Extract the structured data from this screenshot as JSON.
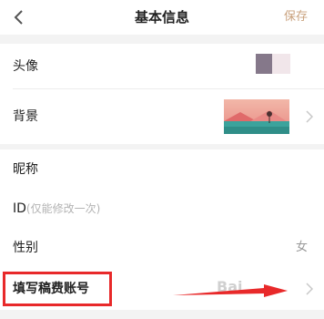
{
  "header": {
    "title": "基本信息",
    "save_label": "保存"
  },
  "rows": {
    "avatar": {
      "label": "头像"
    },
    "background": {
      "label": "背景"
    },
    "nickname": {
      "label": "昵称"
    },
    "id": {
      "label": "ID",
      "hint": "(仅能修改一次)"
    },
    "gender": {
      "label": "性别",
      "value": "女"
    },
    "payee_account": {
      "label": "填写稿费账号"
    }
  },
  "watermark": "Bai"
}
